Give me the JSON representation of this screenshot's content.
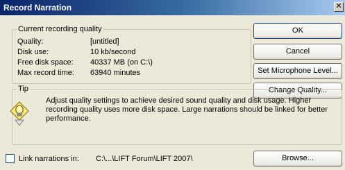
{
  "window": {
    "title": "Record Narration",
    "close_glyph": "✕"
  },
  "quality_group": {
    "legend": "Current recording quality",
    "rows": [
      {
        "label": "Quality:",
        "value": "[untitled]"
      },
      {
        "label": "Disk use:",
        "value": "10 kb/second"
      },
      {
        "label": "Free disk space:",
        "value": "40337 MB (on C:\\)"
      },
      {
        "label": "Max record time:",
        "value": "63940 minutes"
      }
    ]
  },
  "buttons": {
    "ok": "OK",
    "cancel": "Cancel",
    "set_mic": "Set Microphone Level...",
    "change_quality": "Change Quality...",
    "browse": "Browse..."
  },
  "tip": {
    "legend": "Tip",
    "icon": "lightbulb-icon",
    "text": "Adjust quality settings to achieve desired sound quality and disk usage. Higher recording quality uses more disk space. Large narrations should be linked for better performance."
  },
  "link": {
    "label": "Link narrations in:",
    "path": "C:\\...\\LIFT Forum\\LIFT 2007\\",
    "checked": false
  },
  "colors": {
    "accent": "#0a246a",
    "face": "#ece9d8"
  }
}
